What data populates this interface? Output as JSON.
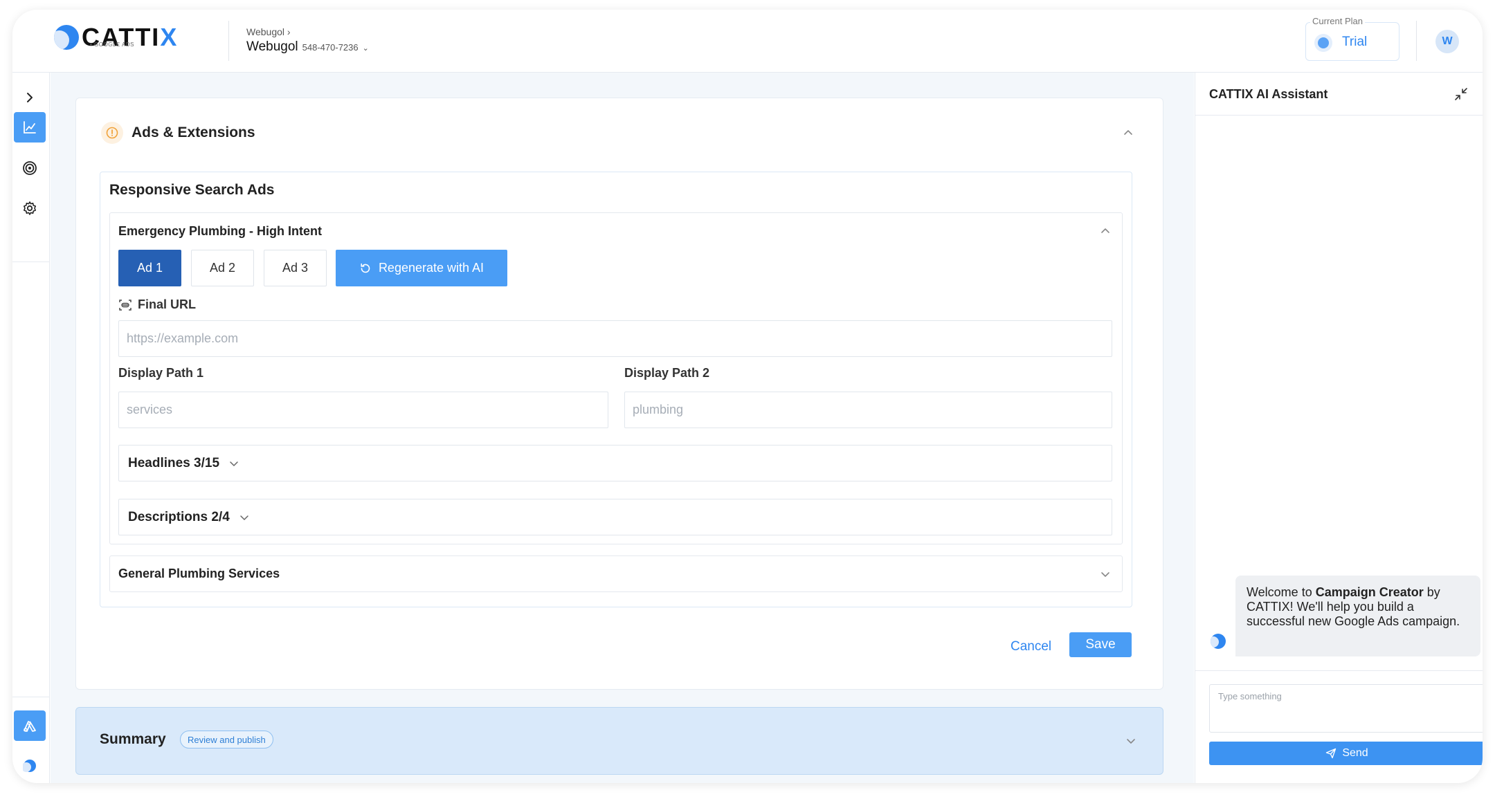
{
  "header": {
    "logo_text": "CATTIX",
    "logo_sub": "• GOOGLE ADS",
    "account_crumb": "Webugol",
    "account_name": "Webugol",
    "account_id": "548-470-7236",
    "plan_label": "Current Plan",
    "plan_name": "Trial",
    "avatar_initial": "W"
  },
  "sidebar": {
    "items": [
      {
        "icon": "chevron-right-icon",
        "active": false
      },
      {
        "icon": "chart-icon",
        "active": true
      },
      {
        "icon": "target-icon",
        "active": false
      },
      {
        "icon": "gear-icon",
        "active": false
      }
    ]
  },
  "section": {
    "title": "Ads & Extensions",
    "rsa_title": "Responsive Search Ads",
    "ad_group_1": {
      "title": "Emergency Plumbing - High Intent",
      "tabs": [
        "Ad 1",
        "Ad 2",
        "Ad 3"
      ],
      "active_tab": "Ad 1",
      "regenerate_label": "Regenerate with AI",
      "final_url_label": "Final URL",
      "final_url_placeholder": "https://example.com",
      "display_path_1_label": "Display Path 1",
      "display_path_1_placeholder": "services",
      "display_path_2_label": "Display Path 2",
      "display_path_2_placeholder": "plumbing",
      "headlines_label": "Headlines 3/15",
      "descriptions_label": "Descriptions 2/4"
    },
    "ad_group_2": {
      "title": "General Plumbing Services"
    },
    "cancel_label": "Cancel",
    "save_label": "Save"
  },
  "summary": {
    "title": "Summary",
    "badge": "Review and publish"
  },
  "assistant": {
    "title": "CATTIX AI Assistant",
    "welcome_pre": "Welcome to ",
    "welcome_bold": "Campaign Creator",
    "welcome_post": " by CATTIX! We'll help you build a successful new Google Ads campaign.",
    "input_placeholder": "Type something",
    "send_label": "Send"
  },
  "colors": {
    "accent": "#4a9df5",
    "active_tab": "#2660b4",
    "summary_bg": "#d9e9fa"
  }
}
